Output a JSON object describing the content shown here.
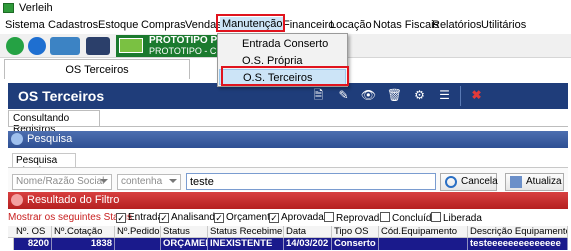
{
  "window": {
    "title": "Verleih"
  },
  "menubar": [
    {
      "label": "Sistema"
    },
    {
      "label": "Cadastros"
    },
    {
      "label": "Estoque"
    },
    {
      "label": "Compras"
    },
    {
      "label": "Vendas"
    },
    {
      "label": "Manutenção"
    },
    {
      "label": "Financeiro"
    },
    {
      "label": "Locação"
    },
    {
      "label": "Notas Fiscais"
    },
    {
      "label": "Relatórios"
    },
    {
      "label": "Utilitários"
    }
  ],
  "banner": {
    "line1": "PROTOTIPO PR",
    "line2": "PROTOTIPO - CNP..."
  },
  "dropdown": [
    {
      "label": "Entrada Conserto"
    },
    {
      "label": "O.S. Própria"
    },
    {
      "label": "O.S. Terceiros"
    }
  ],
  "window_tab": {
    "label": "OS Terceiros"
  },
  "header": {
    "title": "OS Terceiros"
  },
  "subtab": {
    "label": "Consultando Registros"
  },
  "pesquisa": {
    "section_label": "Pesquisa",
    "tab_label": "Pesquisa Simples",
    "field_select": "Nome/Razão Social",
    "operator_select": "contenha",
    "search_value": "teste",
    "cancel_label": "Cancela",
    "update_label": "Atualiza"
  },
  "resultado": {
    "section_label": "Resultado do Filtro"
  },
  "status_filter": {
    "label": "Mostrar os seguintes Status :",
    "options": [
      {
        "label": "Entrada",
        "checked": true
      },
      {
        "label": "Analisando",
        "checked": true
      },
      {
        "label": "Orçamento",
        "checked": true
      },
      {
        "label": "Aprovada",
        "checked": true
      },
      {
        "label": "Reprovada",
        "checked": false
      },
      {
        "label": "Concluída",
        "checked": false
      },
      {
        "label": "Liberada",
        "checked": false
      }
    ]
  },
  "table": {
    "columns": [
      "Nº. OS",
      "Nº.Cotação",
      "Nº.Pedido",
      "Status",
      "Status Recebimento",
      "Data",
      "Tipo OS",
      "Cód.Equipamento",
      "Descrição Equipamento"
    ],
    "rows": [
      [
        "8200",
        "1838",
        "",
        "ORÇAMENT",
        "INEXISTENTE",
        "14/03/202",
        "Conserto",
        "",
        "testeeeeeeeeeeeeee"
      ]
    ]
  },
  "colors": {
    "header_bg": "#1f3d7a",
    "pesquisa_bar": "#3a5ca0",
    "resultado_bar": "#c62b2b",
    "selected_row": "#1a1a8c",
    "highlight_box": "#e0141e"
  }
}
